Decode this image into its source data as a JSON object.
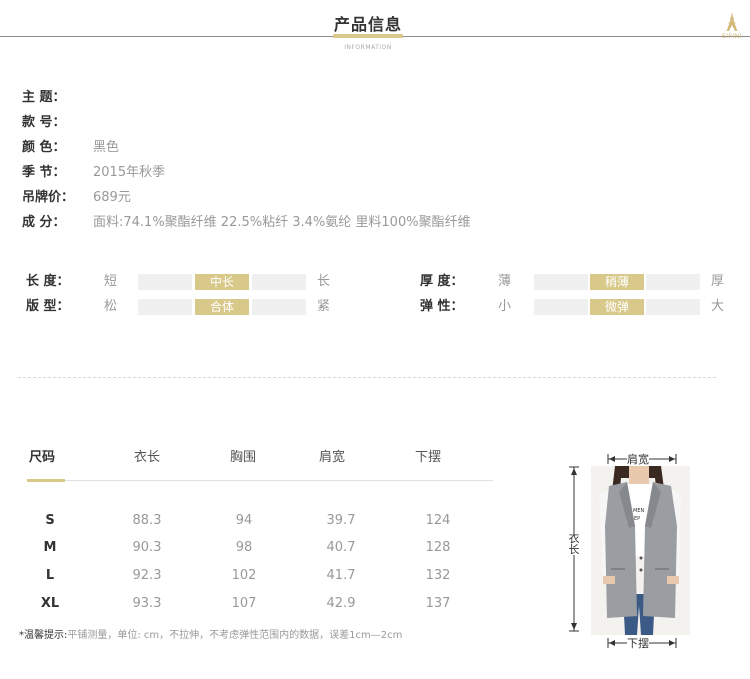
{
  "header": {
    "title": "产品信息",
    "subtitle": "INFORMATION",
    "brand_text": "EIFINI"
  },
  "product_info": [
    {
      "label": "主  题：",
      "value": ""
    },
    {
      "label": "款  号：",
      "value": ""
    },
    {
      "label": "颜  色：",
      "value": "黑色"
    },
    {
      "label": "季  节：",
      "value": "2015年秋季"
    },
    {
      "label": "吊牌价：",
      "value": "689元"
    },
    {
      "label": "成  分：",
      "value": "面料:74.1%聚酯纤维 22.5%粘纤 3.4%氨纶 里料100%聚酯纤维"
    }
  ],
  "attributes": [
    {
      "label": "长  度：",
      "min": "短",
      "max": "长",
      "selected_label": "中长",
      "selected_index": 1
    },
    {
      "label": "版  型：",
      "min": "松",
      "max": "紧",
      "selected_label": "合体",
      "selected_index": 1
    },
    {
      "label": "厚  度：",
      "min": "薄",
      "max": "厚",
      "selected_label": "稍薄",
      "selected_index": 1
    },
    {
      "label": "弹  性：",
      "min": "小",
      "max": "大",
      "selected_label": "微弹",
      "selected_index": 1
    }
  ],
  "size_table": {
    "headers": [
      "尺码",
      "衣长",
      "胸围",
      "肩宽",
      "下摆"
    ],
    "rows": [
      [
        "S",
        "88.3",
        "94",
        "39.7",
        "124"
      ],
      [
        "M",
        "90.3",
        "98",
        "40.7",
        "128"
      ],
      [
        "L",
        "92.3",
        "102",
        "41.7",
        "132"
      ],
      [
        "XL",
        "93.3",
        "107",
        "42.9",
        "137"
      ]
    ]
  },
  "note": {
    "star": "*",
    "label": "温馨提示:",
    "text": "平铺测量，单位: cm，不拉伸，不考虑弹性范围内的数据，误差1cm—2cm"
  },
  "diagram": {
    "shoulder_label": "肩宽",
    "length_label": "衣长",
    "hem_label": "下摆",
    "colors": {
      "vest": "#9a9da2",
      "shirt": "#ffffff",
      "jeans": "#3b5a86",
      "hair": "#3a2a22",
      "skin": "#e9c9ad"
    }
  },
  "colors": {
    "accent": "#d8c98a",
    "track": "#f0f0f0",
    "label": "#333333",
    "muted": "#999999"
  }
}
